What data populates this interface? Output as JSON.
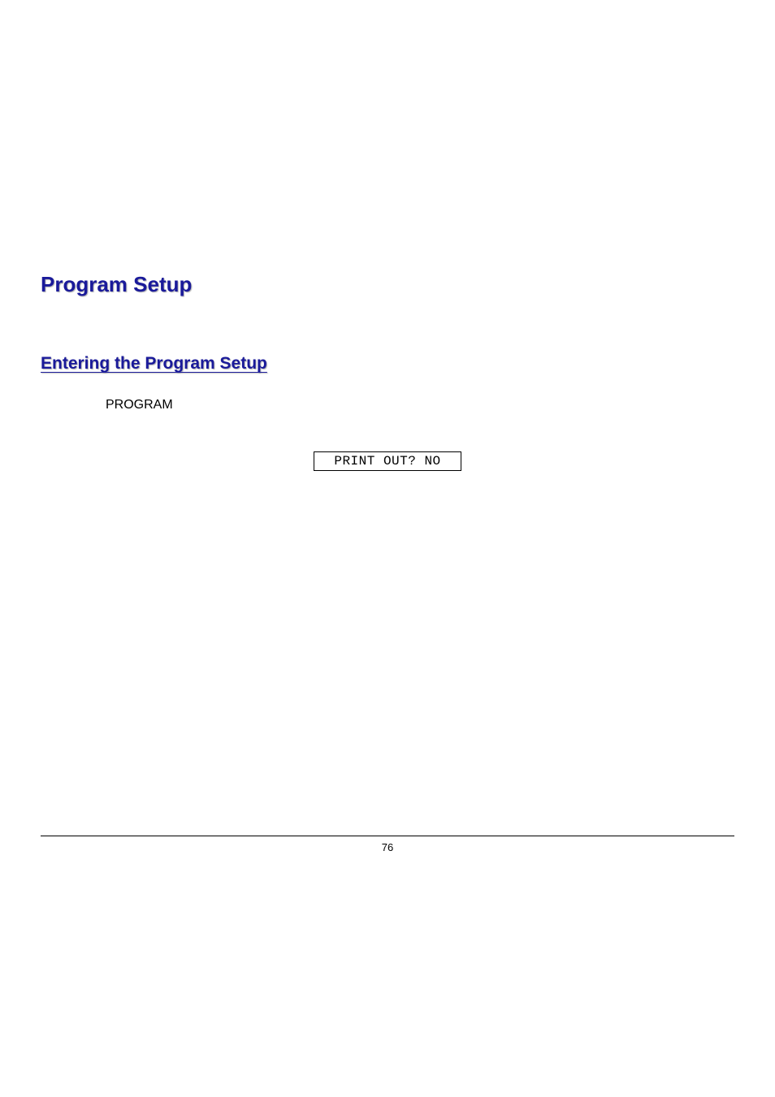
{
  "headings": {
    "h1": "Program Setup",
    "h2": "Entering the Program Setup"
  },
  "labels": {
    "program": "PROGRAM"
  },
  "display": {
    "text": " PRINT OUT? NO "
  },
  "footer": {
    "page_number": "76"
  }
}
